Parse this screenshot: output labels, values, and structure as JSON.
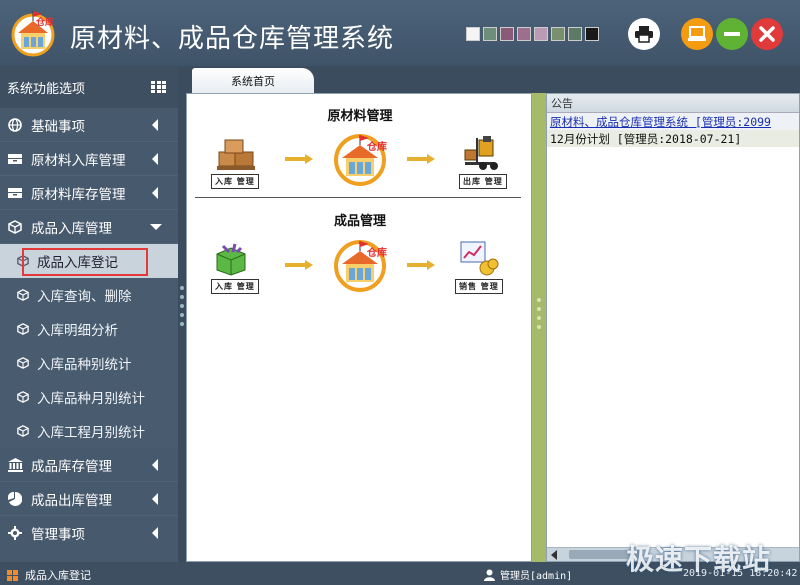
{
  "header": {
    "title": "原材料、成品仓库管理系统",
    "logo_text": "仓库",
    "swatch_colors": [
      "#f4f4f4",
      "#6d8f7a",
      "#8a5b78",
      "#9c6f8c",
      "#b99bb6",
      "#7a8f6e",
      "#5c7a65",
      "#1a1a1a"
    ]
  },
  "sidebar": {
    "heading": "系统功能选项",
    "items": [
      {
        "label": "基础事项",
        "icon": "globe-icon"
      },
      {
        "label": "原材料入库管理",
        "icon": "drawer-icon"
      },
      {
        "label": "原材料库存管理",
        "icon": "drawer-icon"
      },
      {
        "label": "成品入库管理",
        "icon": "cube-icon",
        "expanded": true
      },
      {
        "label": "成品库存管理",
        "icon": "bank-icon"
      },
      {
        "label": "成品出库管理",
        "icon": "pie-icon"
      },
      {
        "label": "管理事项",
        "icon": "gear-icon"
      }
    ],
    "sub_items": [
      {
        "label": "成品入库登记",
        "active": true
      },
      {
        "label": "入库查询、删除"
      },
      {
        "label": "入库明细分析"
      },
      {
        "label": "入库品种别统计"
      },
      {
        "label": "入库品种月别统计"
      },
      {
        "label": "入库工程月别统计"
      }
    ]
  },
  "tabs": [
    {
      "label": "系统首页"
    }
  ],
  "main": {
    "raw_title": "原材料管理",
    "raw_in_label": "入库 管理",
    "raw_out_label": "出库 管理",
    "warehouse_text": "仓库",
    "product_title": "成品管理",
    "product_in_label": "入库 管理",
    "product_sales_label": "销售 管理"
  },
  "notice": {
    "heading": "公告",
    "rows": [
      "原材料、成品仓库管理系统 [管理员:2099",
      "12月份计划 [管理员:2018-07-21]"
    ]
  },
  "statusbar": {
    "current": "成品入库登记",
    "user": "管理员[admin]",
    "time": "2019-01-15 18:20:42"
  },
  "watermark": "极速下载站"
}
